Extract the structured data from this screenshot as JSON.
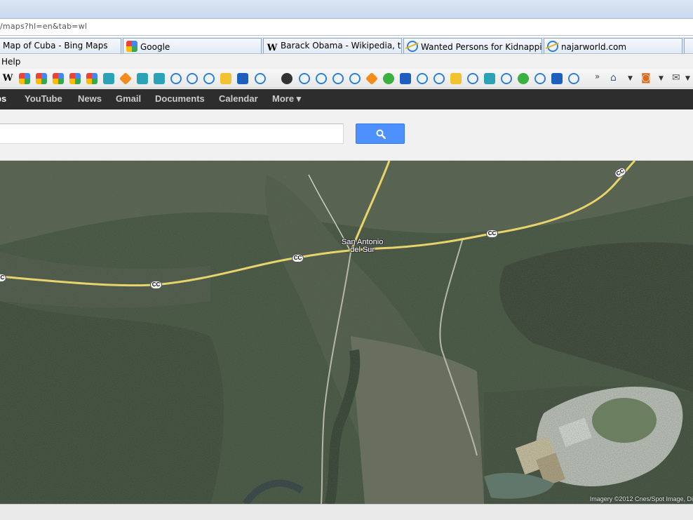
{
  "browser": {
    "address": "/maps?hl=en&tab=wl",
    "tabs": [
      {
        "label": "Map of Cuba - Bing Maps",
        "icon": "none"
      },
      {
        "label": "Google",
        "icon": "google-icon"
      },
      {
        "label": "Barack Obama - Wikipedia, th...",
        "icon": "wikipedia-icon"
      },
      {
        "label": "Wanted Persons for Kidnapping",
        "icon": "ie-icon"
      },
      {
        "label": "najarworld.com",
        "icon": "ie-icon"
      }
    ],
    "menu": {
      "help": "Help"
    },
    "toolbar": {
      "wiki_glyph": "W",
      "overflow": "»"
    }
  },
  "google_bar": {
    "items": [
      "ps",
      "YouTube",
      "News",
      "Gmail",
      "Documents",
      "Calendar",
      "More ▾"
    ]
  },
  "search": {
    "value": "",
    "button_icon": "search-icon"
  },
  "map": {
    "place_label": "San Antonio\ndel Sur",
    "road_shield": "CC",
    "attribution": "Imagery ©2012 Cnes/Spot Image, Di"
  },
  "colors": {
    "google_blue": "#4d90fe",
    "gbar_bg": "#2d2d2d",
    "road": "#e8d46a"
  }
}
